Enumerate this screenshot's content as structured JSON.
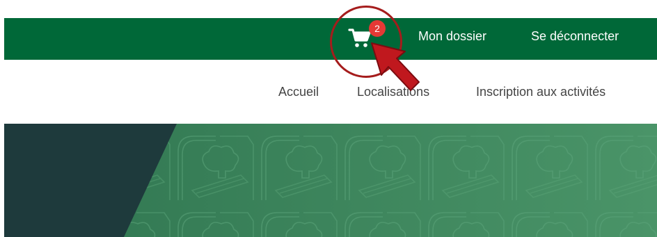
{
  "top_bar": {
    "cart_icon": "shopping-cart-icon",
    "cart_count": "2",
    "my_account_label": "Mon dossier",
    "logout_label": "Se déconnecter"
  },
  "main_nav": {
    "items": [
      {
        "label": "Accueil"
      },
      {
        "label": "Localisations"
      },
      {
        "label": "Inscription aux activités"
      }
    ]
  },
  "annotation": {
    "highlight": "red-circle",
    "pointer": "red-arrow-icon"
  },
  "colors": {
    "top_bar_bg": "#006838",
    "badge_bg": "#e53935",
    "hero_green": "#3d8a5e",
    "hero_dark": "#1e3a3c",
    "annotation_red": "#a51c1c"
  }
}
